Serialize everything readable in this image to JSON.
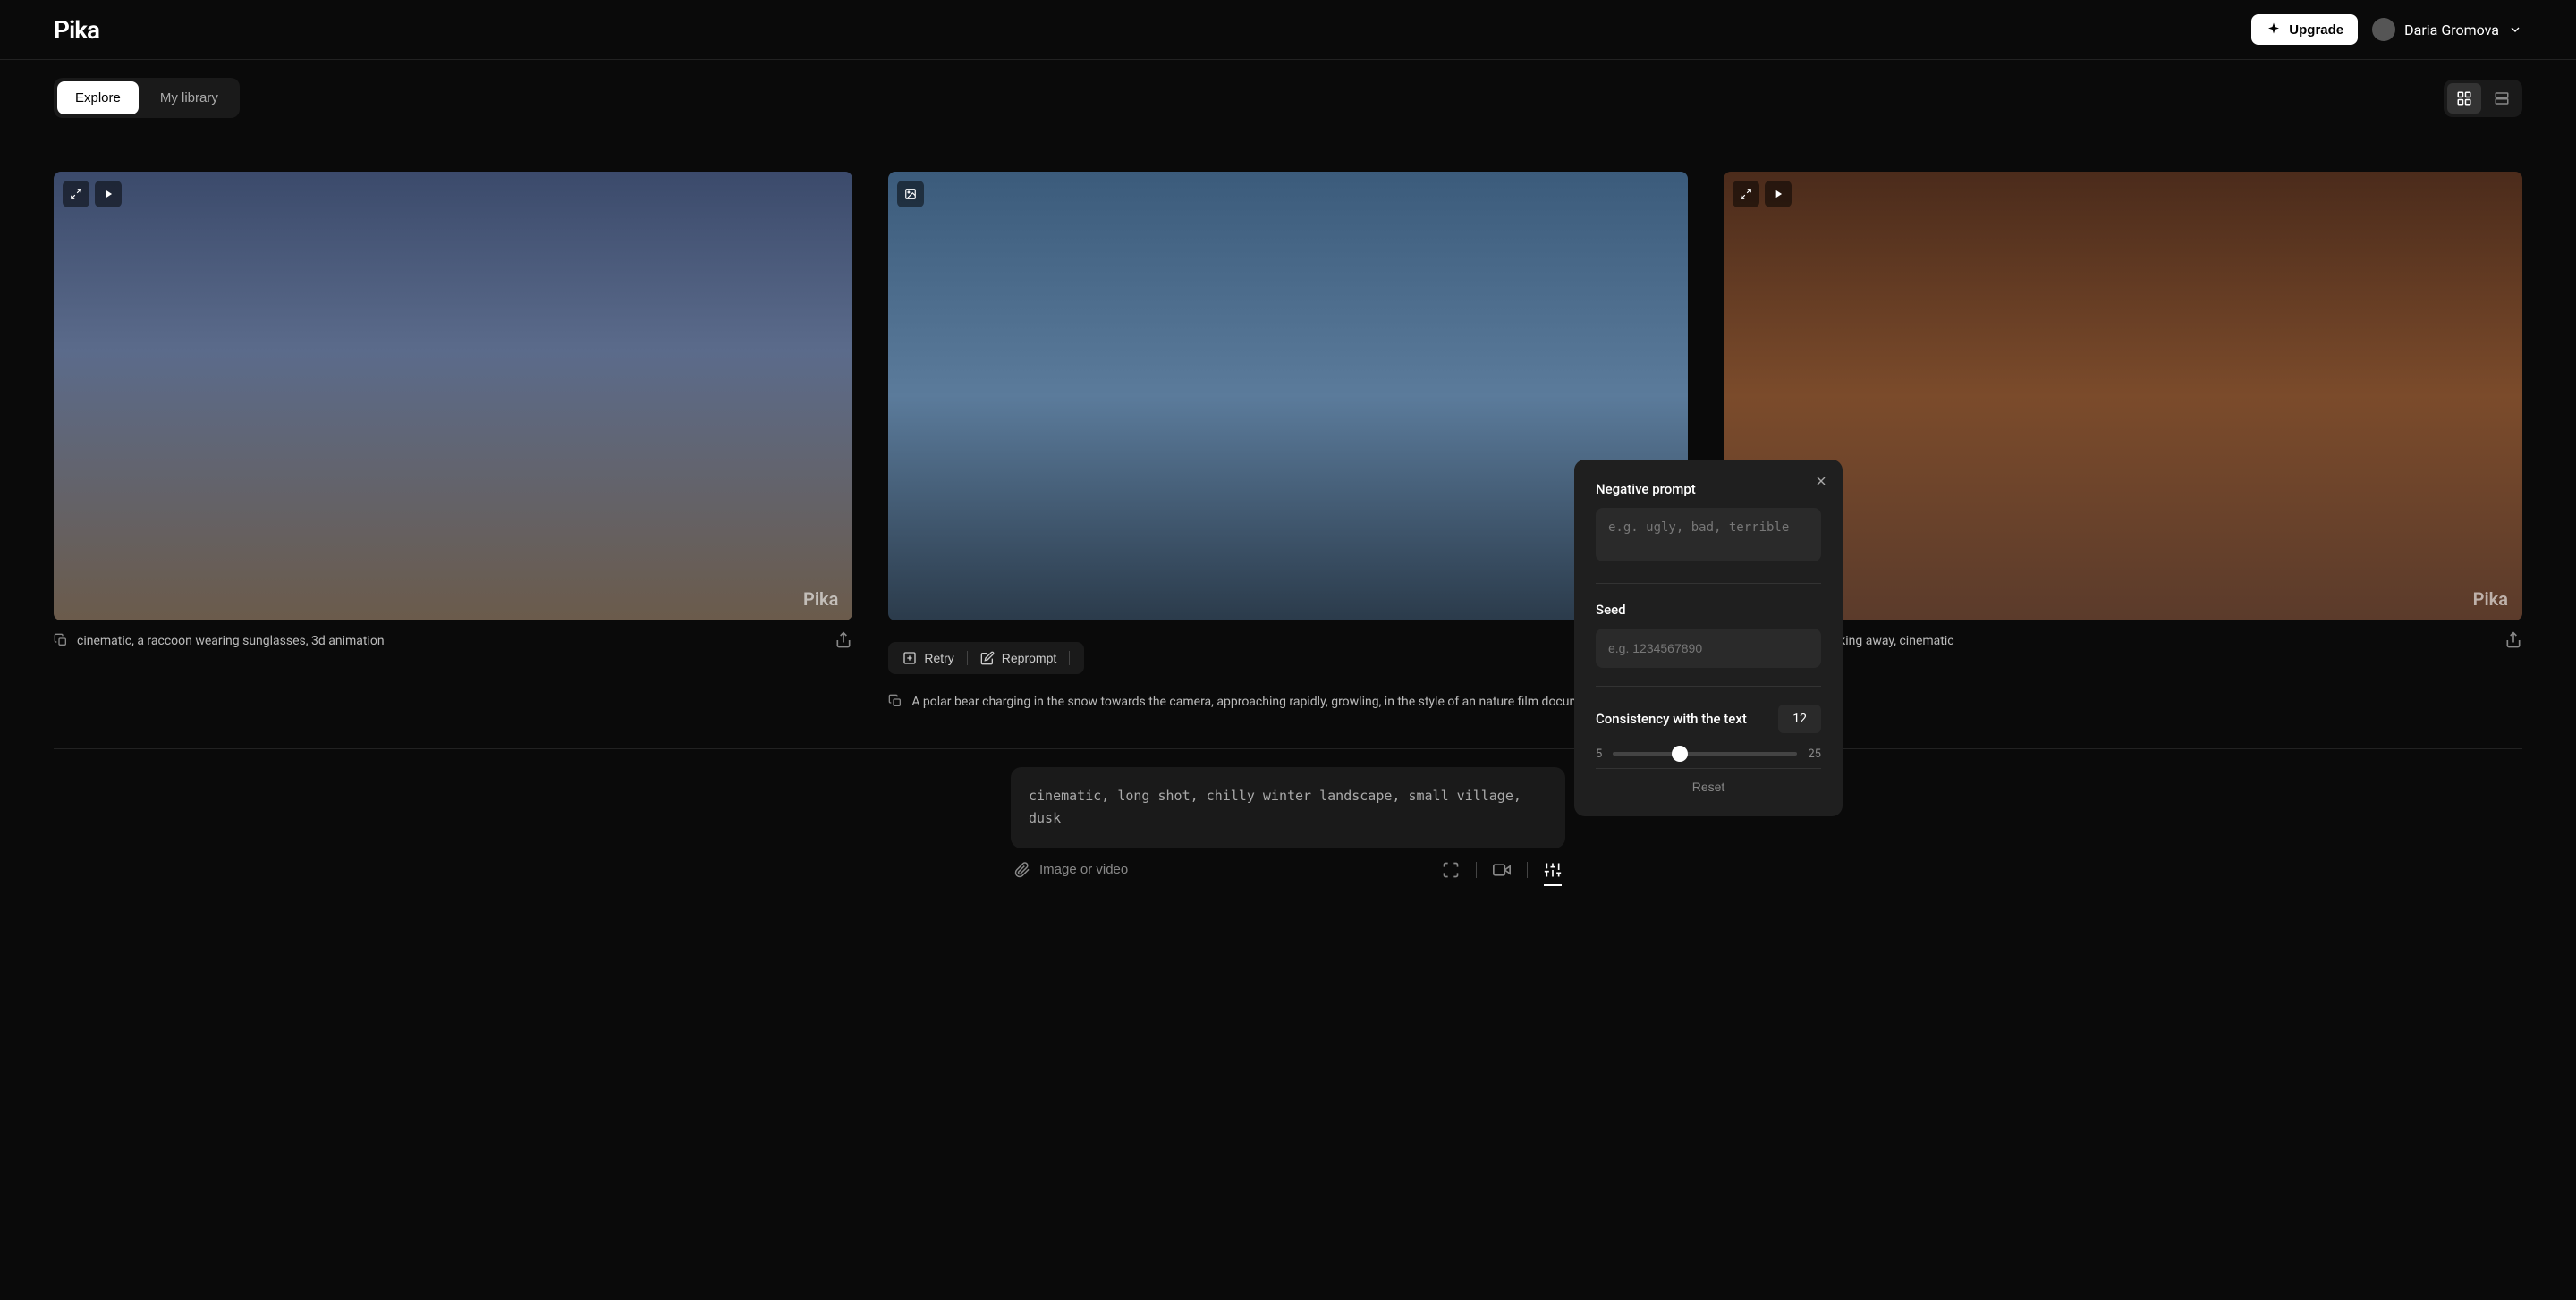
{
  "header": {
    "logo": "Pika",
    "upgrade_label": "Upgrade",
    "user_name": "Daria Gromova"
  },
  "tabs": {
    "explore": "Explore",
    "library": "My library"
  },
  "cards": [
    {
      "watermark": "Pika",
      "description": "cinematic, a raccoon wearing sunglasses, 3d animation"
    },
    {
      "watermark": "",
      "retry": "Retry",
      "reprompt": "Reprompt",
      "description": "A polar bear charging in the snow towards the camera, approaching rapidly, growling, in the style of an nature film docume..."
    },
    {
      "watermark": "Pika",
      "description": "an astronaut walking away, cinematic"
    }
  ],
  "prompt": {
    "value": "cinematic, long shot, chilly winter landscape, small village, dusk",
    "attach_label": "Image or video"
  },
  "popover": {
    "negative_label": "Negative prompt",
    "negative_placeholder": "e.g. ugly, bad, terrible",
    "seed_label": "Seed",
    "seed_placeholder": "e.g. 1234567890",
    "consistency_label": "Consistency with the text",
    "consistency_value": "12",
    "slider_min": "5",
    "slider_max": "25",
    "reset_label": "Reset"
  }
}
